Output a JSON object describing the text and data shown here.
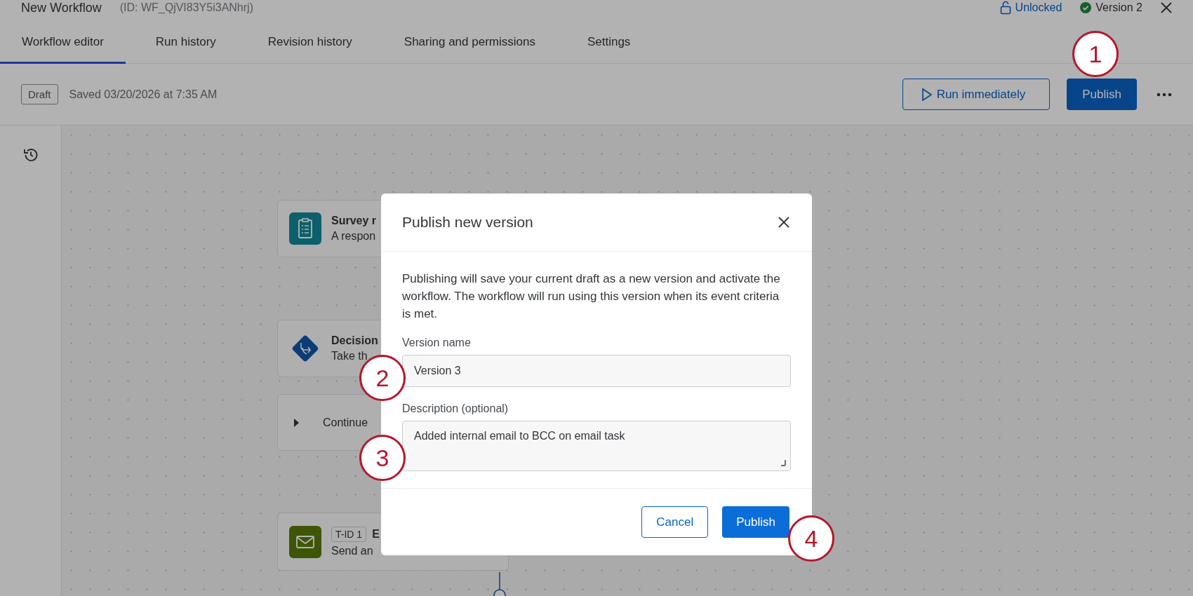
{
  "window": {
    "title": "New Workflow",
    "id_label": "(ID: WF_QjVI83Y5i3ANhrj)",
    "lock_status": "Unlocked",
    "version": "Version 2"
  },
  "tabs": [
    {
      "label": "Workflow editor",
      "selected": true
    },
    {
      "label": "Run history",
      "selected": false
    },
    {
      "label": "Revision history",
      "selected": false
    },
    {
      "label": "Sharing and permissions",
      "selected": false
    },
    {
      "label": "Settings",
      "selected": false
    }
  ],
  "toolbar": {
    "status_badge": "Draft",
    "saved": "Saved 03/20/2026 at 7:35 AM",
    "run_button": "Run immediately",
    "publish_button": "Publish"
  },
  "canvas": {
    "nodes": [
      {
        "kind": "survey",
        "title": "Survey r",
        "subtitle": "A respon"
      },
      {
        "kind": "decision",
        "title": "Decision",
        "subtitle": "Take th"
      },
      {
        "kind": "branch",
        "title": "Continue"
      },
      {
        "kind": "email",
        "tag": "T-ID 1",
        "title": "E",
        "subtitle": "Send an"
      }
    ]
  },
  "dialog": {
    "title": "Publish new version",
    "message": "Publishing will save your current draft as a new version and activate the workflow. The workflow will run using this version when its event criteria is met.",
    "version_label": "Version name",
    "version_value": "Version 3",
    "description_label": "Description (optional)",
    "description_value": "Added internal email to BCC on email task",
    "cancel_button": "Cancel",
    "publish_button": "Publish"
  },
  "callouts": [
    "1",
    "2",
    "3",
    "4"
  ]
}
